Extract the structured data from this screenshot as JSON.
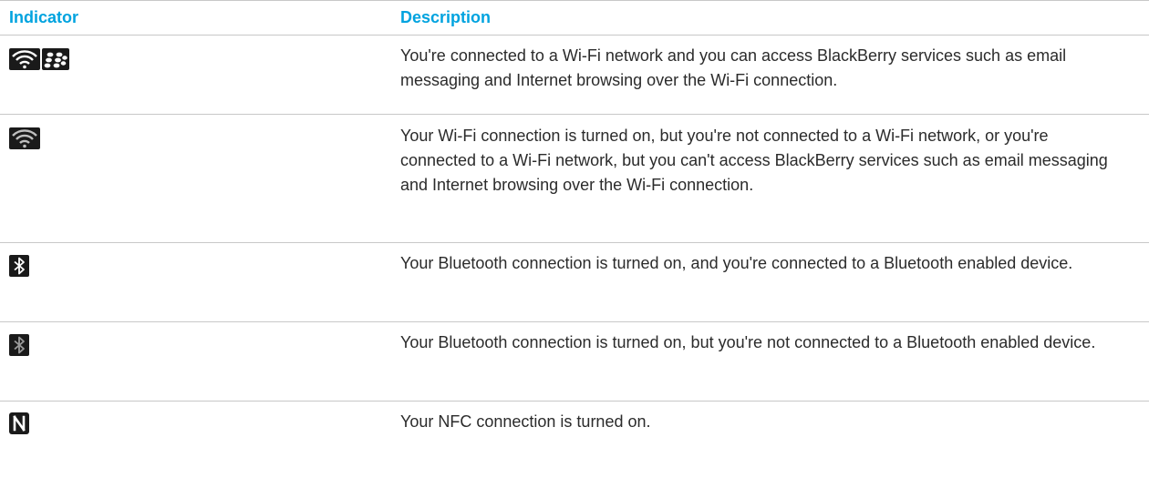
{
  "table": {
    "headers": {
      "indicator": "Indicator",
      "description": "Description"
    },
    "rows": [
      {
        "icon": "wifi-blackberry-icon",
        "description": "You're connected to a Wi-Fi network and you can access BlackBerry services such as email messaging and Internet browsing over the Wi-Fi connection."
      },
      {
        "icon": "wifi-icon",
        "description": "Your Wi-Fi connection is turned on, but you're not connected to a Wi-Fi network, or you're connected to a Wi-Fi network, but you can't access BlackBerry services such as email messaging and Internet browsing over the Wi-Fi connection."
      },
      {
        "icon": "bluetooth-connected-icon",
        "description": "Your Bluetooth connection is turned on, and you're connected to a Bluetooth enabled device."
      },
      {
        "icon": "bluetooth-icon",
        "description": "Your Bluetooth connection is turned on, but you're not connected to a Bluetooth enabled device."
      },
      {
        "icon": "nfc-icon",
        "description": "Your NFC connection is turned on."
      }
    ]
  },
  "colors": {
    "header_text": "#00a3df",
    "body_text": "#2b2b2b",
    "rule": "#c8c8c8",
    "icon_bg": "#1a1a1a"
  }
}
